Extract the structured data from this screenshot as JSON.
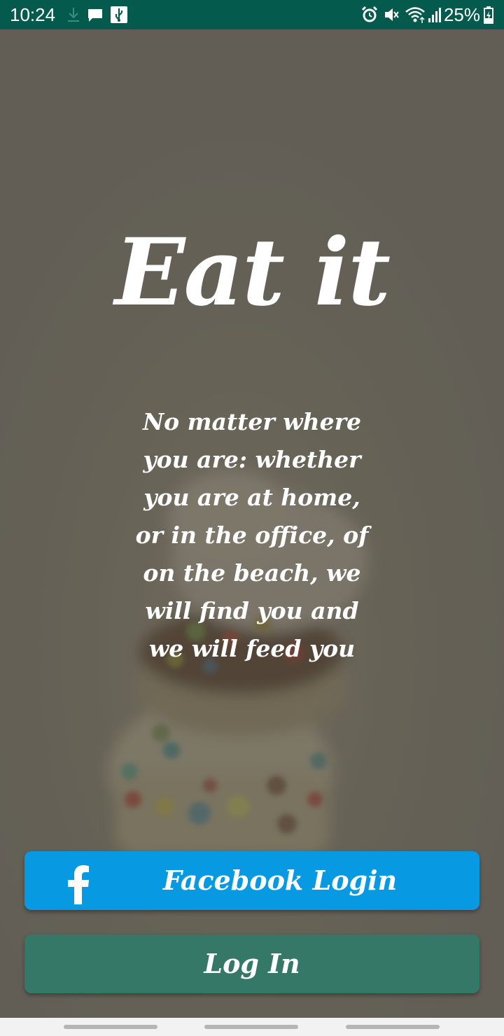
{
  "status_bar": {
    "time": "10:24",
    "battery_percent": "25%",
    "background_color": "#045a4c",
    "left_icons": [
      "download-icon",
      "message-icon",
      "usb-icon"
    ],
    "right_icons": [
      "alarm-icon",
      "mute-icon",
      "wifi-icon",
      "signal-icon",
      "battery-icon"
    ]
  },
  "main": {
    "title": "Eat it",
    "tagline": "No matter where you are: whether you are at home, or in the office, of on the beach, we will find you and we will feed you"
  },
  "buttons": {
    "facebook_login_label": "Facebook Login",
    "facebook_color": "#079ae3",
    "login_label": "Log In",
    "login_color": "#367868"
  },
  "nav_bar": {
    "background_color": "#f2f2f2"
  }
}
